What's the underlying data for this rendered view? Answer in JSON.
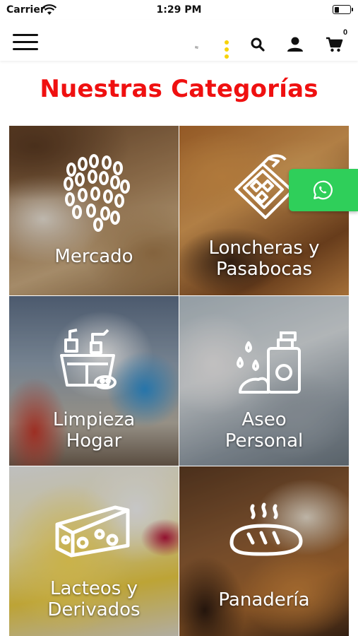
{
  "status_bar": {
    "carrier": "Carrier",
    "time": "1:29 PM",
    "battery_level": 0.3
  },
  "header": {
    "icons": [
      "menu-icon",
      "search-icon",
      "user-icon",
      "cart-icon"
    ],
    "logo_text": "≈",
    "cart_count": "0",
    "accent_color": "#f7d308"
  },
  "page": {
    "title": "Nuestras Categorías",
    "title_color": "#ef1010"
  },
  "categories": [
    {
      "line1": "Mercado",
      "line2": ""
    },
    {
      "line1": "Loncheras y",
      "line2": "Pasabocas"
    },
    {
      "line1": "Limpieza",
      "line2": "Hogar"
    },
    {
      "line1": "Aseo",
      "line2": "Personal"
    },
    {
      "line1": "Lacteos y",
      "line2": "Derivados"
    },
    {
      "line1": "Panadería",
      "line2": ""
    }
  ],
  "whatsapp": {
    "icon": "whatsapp-icon",
    "color": "#2fcf5a"
  }
}
